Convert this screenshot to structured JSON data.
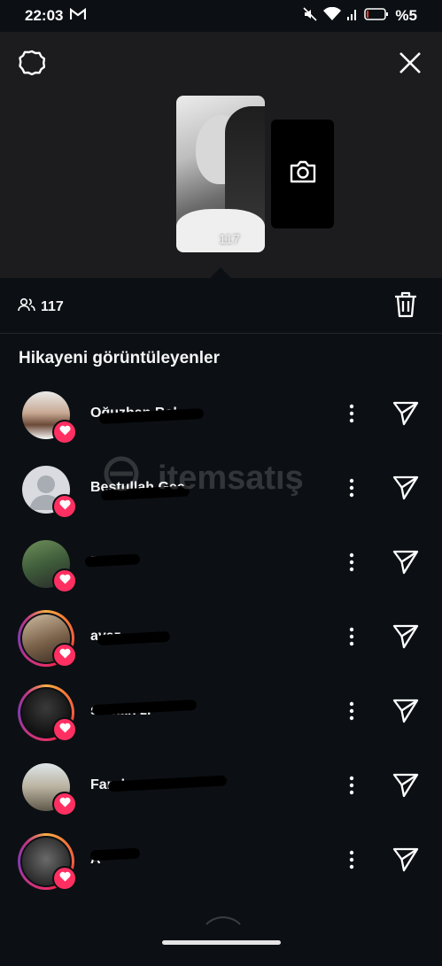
{
  "status_bar": {
    "time": "22:03",
    "battery": "%5",
    "icons": [
      "gmail-icon",
      "mute-icon",
      "wifi-icon",
      "signal-icon",
      "battery-icon"
    ]
  },
  "story": {
    "view_count": "117",
    "icons": [
      "settings-icon",
      "close-icon",
      "camera-icon"
    ]
  },
  "viewers_bar": {
    "count": "117",
    "icons": [
      "people-icon",
      "trash-icon"
    ]
  },
  "section_title": "Hikayeni görüntüleyenler",
  "watermark": "itemsatış",
  "viewers": [
    {
      "name": "Oğuzhan Balcı",
      "ring": false,
      "liked": true
    },
    {
      "name": "Bestullah Geç",
      "ring": false,
      "liked": true
    },
    {
      "name": "B G",
      "ring": false,
      "liked": true
    },
    {
      "name": "ayaz",
      "ring": true,
      "liked": true
    },
    {
      "name": "serkan zi",
      "ring": true,
      "liked": true
    },
    {
      "name": "Faruk",
      "ring": false,
      "liked": true
    },
    {
      "name": "A",
      "ring": true,
      "liked": true
    }
  ],
  "colors": {
    "background": "#0c1014",
    "header": "#1c1c1e",
    "heart": "#ff3061"
  }
}
